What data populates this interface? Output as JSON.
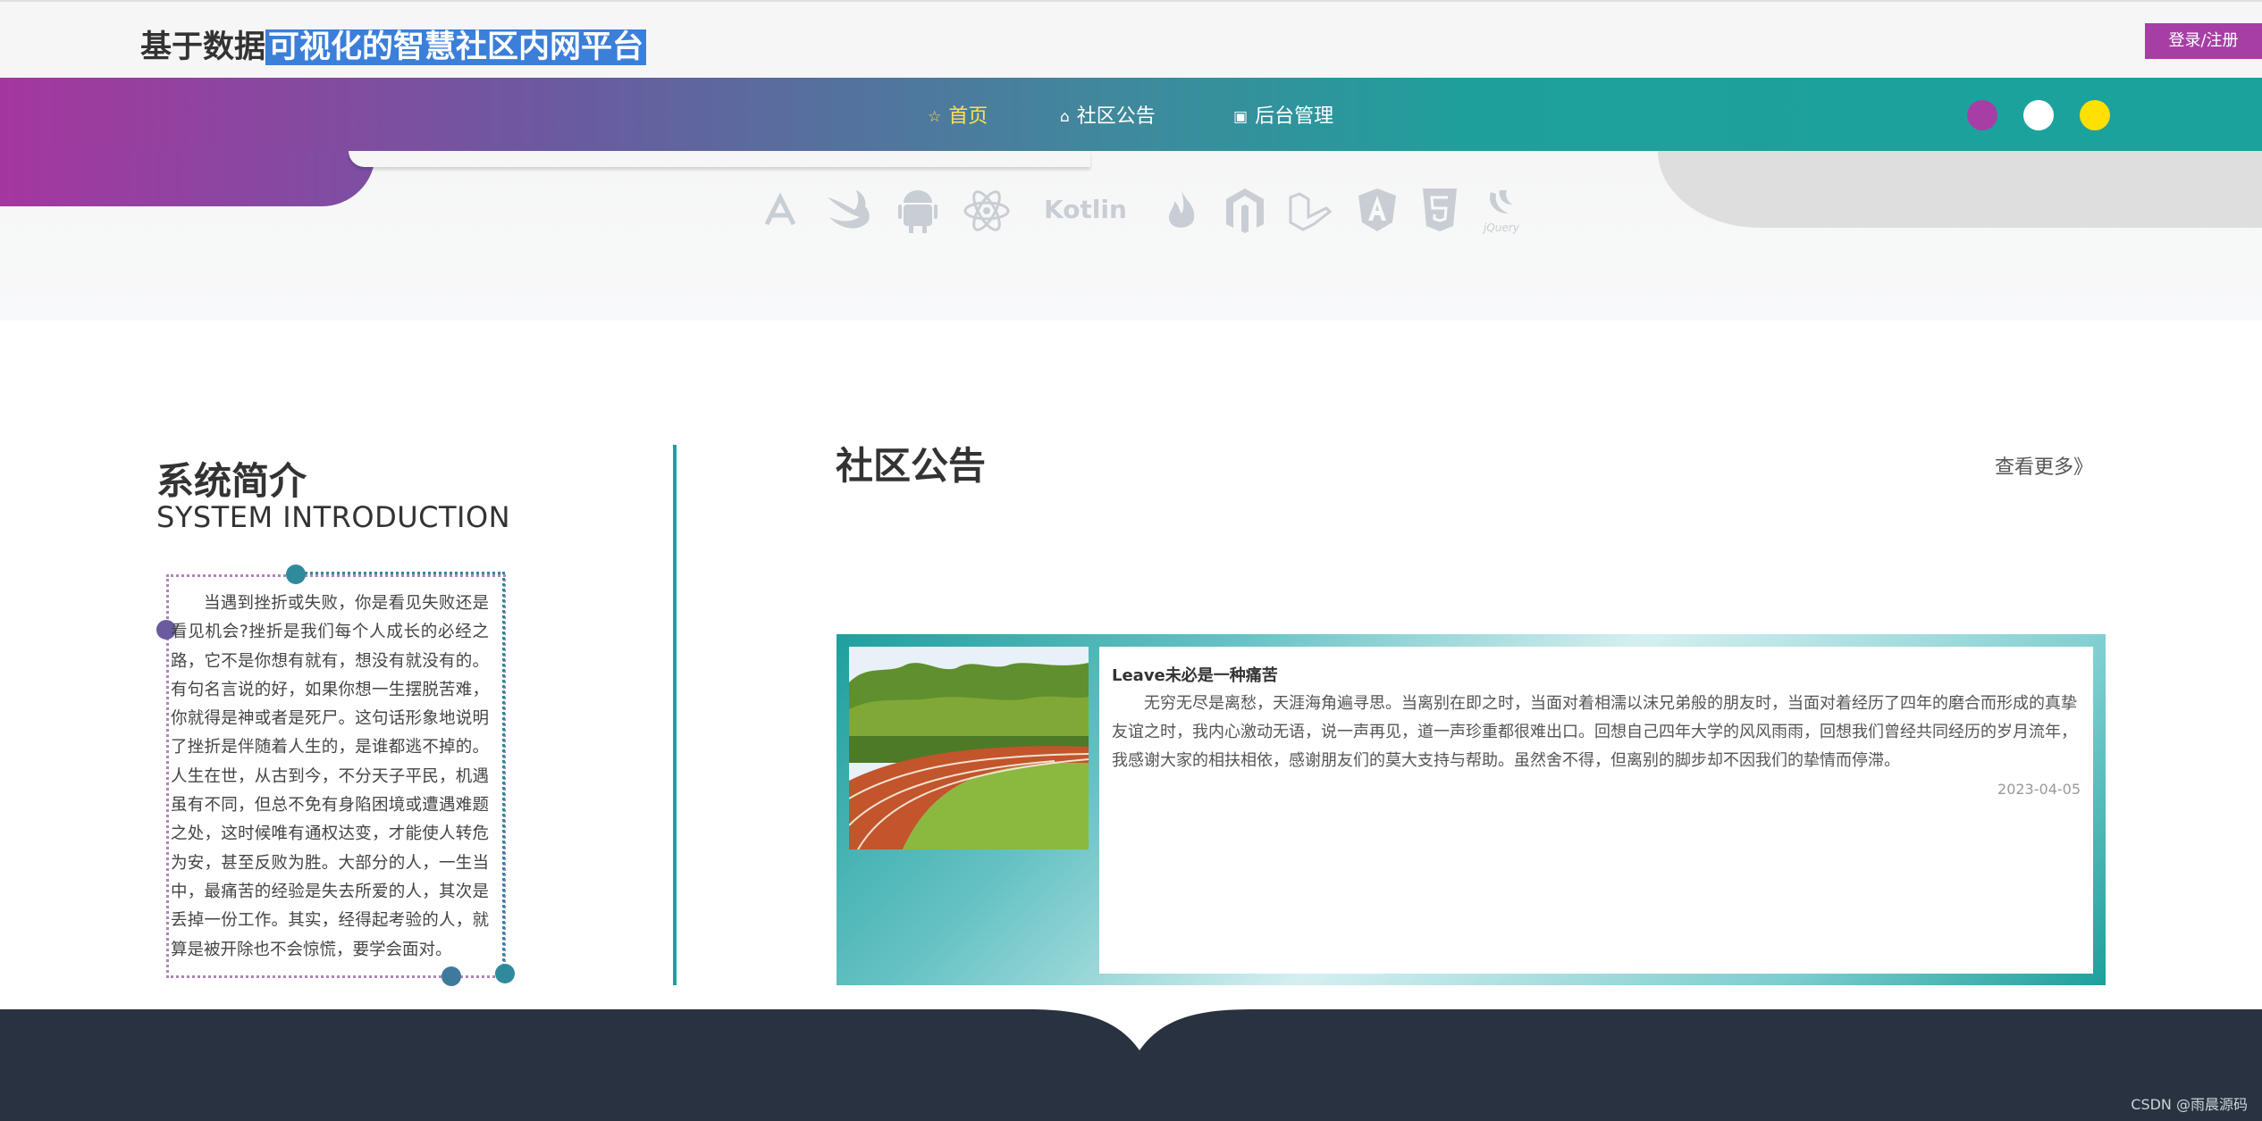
{
  "header": {
    "title_plain": "基于数据",
    "title_highlight": "可视化的智慧社区内网平台",
    "login_label": "登录/注册"
  },
  "nav": {
    "items": [
      {
        "icon": "☆",
        "label": "首页"
      },
      {
        "icon": "⌂",
        "label": "社区公告"
      },
      {
        "icon": "▣",
        "label": "后台管理"
      }
    ],
    "theme_dots": [
      "#a73ea5",
      "#ffffff",
      "#ffe000"
    ]
  },
  "tech_icons": [
    "A",
    "swift",
    "android",
    "react",
    "Kotlin",
    "flame",
    "magento",
    "laravel",
    "angular",
    "html5",
    "jQuery"
  ],
  "intro": {
    "title": "系统简介",
    "subtitle": "SYSTEM INTRODUCTION",
    "text": "当遇到挫折或失败，你是看见失败还是看见机会?挫折是我们每个人成长的必经之路，它不是你想有就有，想没有就没有的。有句名言说的好，如果你想一生摆脱苦难，你就得是神或者是死尸。这句话形象地说明了挫折是伴随着人生的，是谁都逃不掉的。人生在世，从古到今，不分天子平民，机遇虽有不同，但总不免有身陷困境或遭遇难题之处，这时候唯有通权达变，才能使人转危为安，甚至反败为胜。大部分的人，一生当中，最痛苦的经验是失去所爱的人，其次是丢掉一份工作。其实，经得起考验的人，就算是被开除也不会惊慌，要学会面对。"
  },
  "notice": {
    "title": "社区公告",
    "more_label": "查看更多》",
    "item": {
      "headline": "Leave未必是一种痛苦",
      "text": "无穷无尽是离愁，天涯海角遍寻思。当离别在即之时，当面对着相濡以沫兄弟般的朋友时，当面对着经历了四年的磨合而形成的真挚友谊之时，我内心激动无语，说一声再见，道一声珍重都很难出口。回想自己四年大学的风风雨雨，回想我们曾经共同经历的岁月流年，我感谢大家的相扶相依，感谢朋友们的莫大支持与帮助。虽然舍不得，但离别的脚步却不因我们的挚情而停滞。",
      "date": "2023-04-05"
    }
  },
  "watermark": "CSDN @雨晨源码"
}
